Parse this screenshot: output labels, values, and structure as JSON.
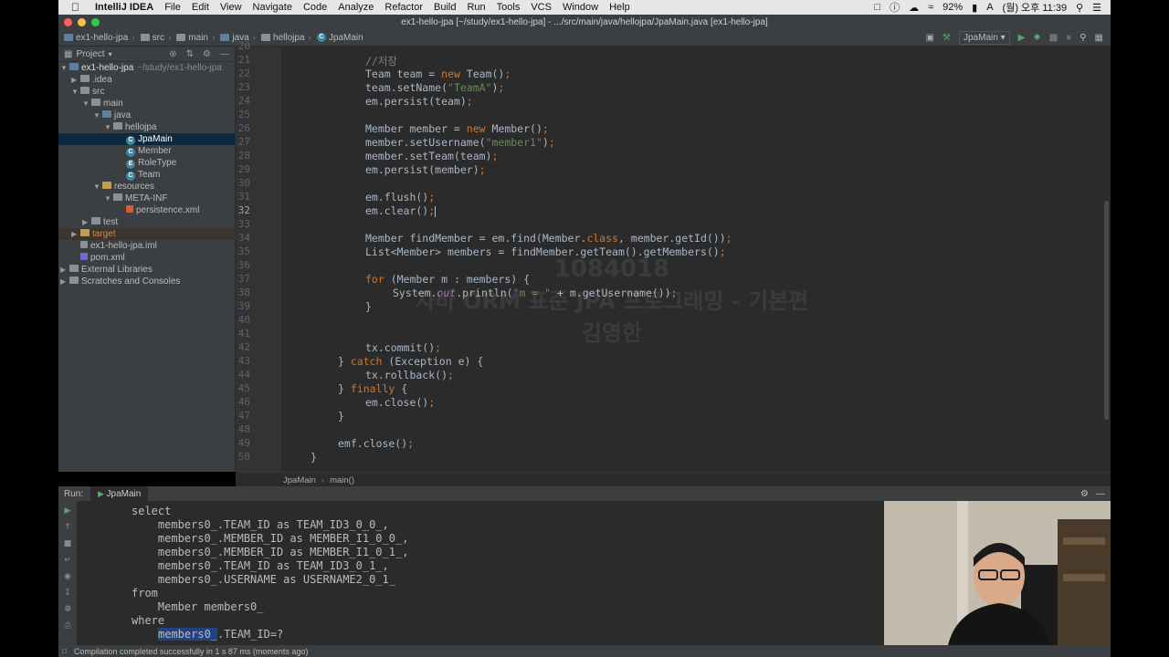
{
  "menubar": {
    "app": "IntelliJ IDEA",
    "items": [
      "File",
      "Edit",
      "View",
      "Navigate",
      "Code",
      "Analyze",
      "Refactor",
      "Build",
      "Run",
      "Tools",
      "VCS",
      "Window",
      "Help"
    ],
    "battery": "92%",
    "clock": "(월) 오후 11:39"
  },
  "window": {
    "title": "ex1-hello-jpa [~/study/ex1-hello-jpa] - .../src/main/java/hellojpa/JpaMain.java [ex1-hello-jpa]"
  },
  "navbar": {
    "crumbs": [
      "ex1-hello-jpa",
      "src",
      "main",
      "java",
      "hellojpa",
      "JpaMain"
    ],
    "run_config": "JpaMain"
  },
  "project": {
    "header": "Project",
    "tree": [
      {
        "label": "ex1-hello-jpa",
        "extra": "~/study/ex1-hello-jpa"
      },
      {
        "label": ".idea"
      },
      {
        "label": "src"
      },
      {
        "label": "main"
      },
      {
        "label": "java"
      },
      {
        "label": "hellojpa"
      },
      {
        "label": "JpaMain"
      },
      {
        "label": "Member"
      },
      {
        "label": "RoleType"
      },
      {
        "label": "Team"
      },
      {
        "label": "resources"
      },
      {
        "label": "META-INF"
      },
      {
        "label": "persistence.xml"
      },
      {
        "label": "test"
      },
      {
        "label": "target"
      },
      {
        "label": "ex1-hello-jpa.iml"
      },
      {
        "label": "pom.xml"
      },
      {
        "label": "External Libraries"
      },
      {
        "label": "Scratches and Consoles"
      }
    ]
  },
  "editor": {
    "line_numbers": [
      "20",
      "21",
      "22",
      "23",
      "24",
      "25",
      "26",
      "27",
      "28",
      "29",
      "30",
      "31",
      "32",
      "33",
      "34",
      "35",
      "36",
      "37",
      "38",
      "39",
      "40",
      "41",
      "42",
      "43",
      "44",
      "45",
      "46",
      "47",
      "48",
      "49",
      "50"
    ],
    "current_line": "32",
    "breadcrumb": [
      "JpaMain",
      "main()"
    ],
    "watermark": [
      "1084018",
      "자바 ORM 표준 JPA 프로그래밍 - 기본편",
      "김영한"
    ]
  },
  "run": {
    "label": "Run:",
    "tab": "JpaMain",
    "console": [
      "select",
      "    members0_.TEAM_ID as TEAM_ID3_0_0_,",
      "    members0_.MEMBER_ID as MEMBER_I1_0_0_,",
      "    members0_.MEMBER_ID as MEMBER_I1_0_1_,",
      "    members0_.TEAM_ID as TEAM_ID3_0_1_,",
      "    members0_.USERNAME as USERNAME2_0_1_",
      "from",
      "    Member members0_",
      "where",
      "members0_",
      ".TEAM_ID=?"
    ]
  },
  "status": {
    "message": "Compilation completed successfully in 1 s 87 ms (moments ago)"
  }
}
